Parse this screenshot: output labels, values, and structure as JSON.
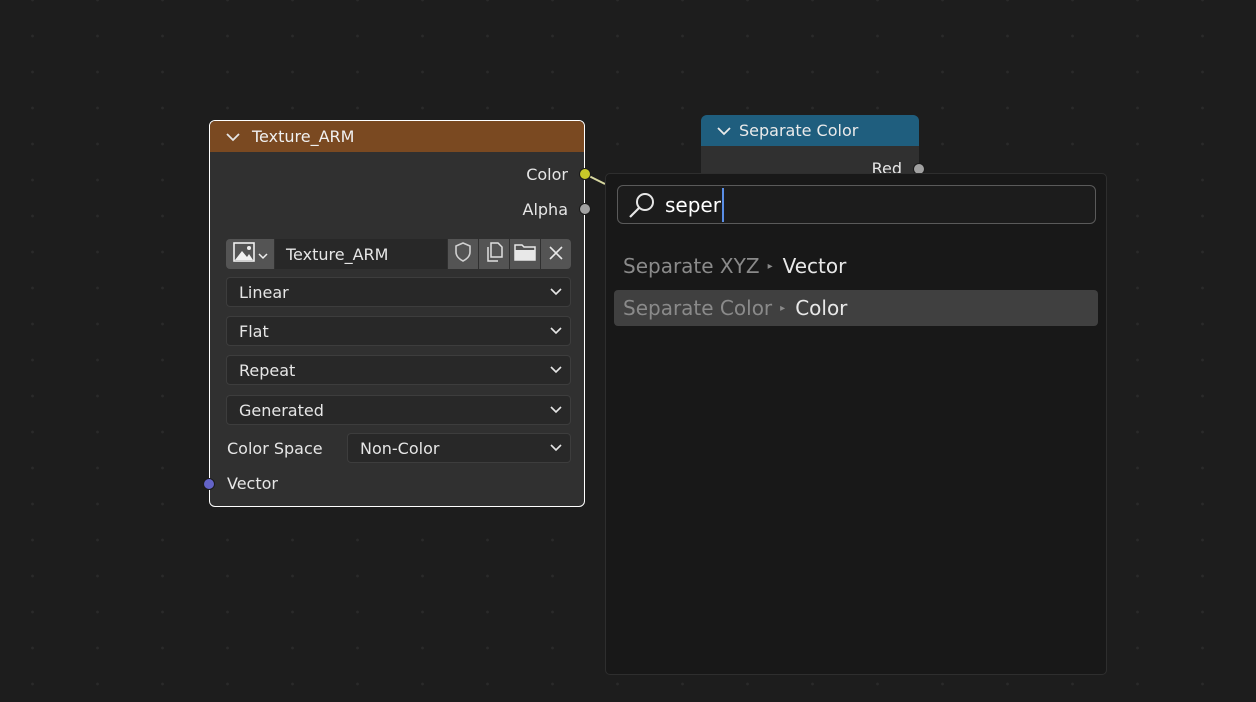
{
  "texture_node": {
    "title": "Texture_ARM",
    "outputs": [
      "Color",
      "Alpha"
    ],
    "image_name": "Texture_ARM",
    "interpolation": "Linear",
    "projection": "Flat",
    "extension": "Repeat",
    "source": "Generated",
    "color_space_label": "Color Space",
    "color_space": "Non-Color",
    "input_vector": "Vector",
    "colors": {
      "header": "#7a4921",
      "color_socket": "#c7c729",
      "alpha_socket": "#a1a1a1",
      "vector_socket": "#6363c7"
    }
  },
  "separate_node": {
    "title": "Separate Color",
    "first_output": "Red",
    "colors": {
      "header": "#1f5e7e"
    }
  },
  "search_menu": {
    "query": "seper",
    "results": [
      {
        "path": "Separate XYZ",
        "name": "Vector",
        "active": false
      },
      {
        "path": "Separate Color",
        "name": "Color",
        "active": true
      }
    ],
    "colors": {
      "caret": "#5a8ee6",
      "highlight": "#404040"
    }
  },
  "icons": [
    "chevron-down-icon",
    "image-icon",
    "shield-icon",
    "duplicate-icon",
    "folder-icon",
    "close-icon",
    "search-icon",
    "submenu-arrow-icon"
  ]
}
